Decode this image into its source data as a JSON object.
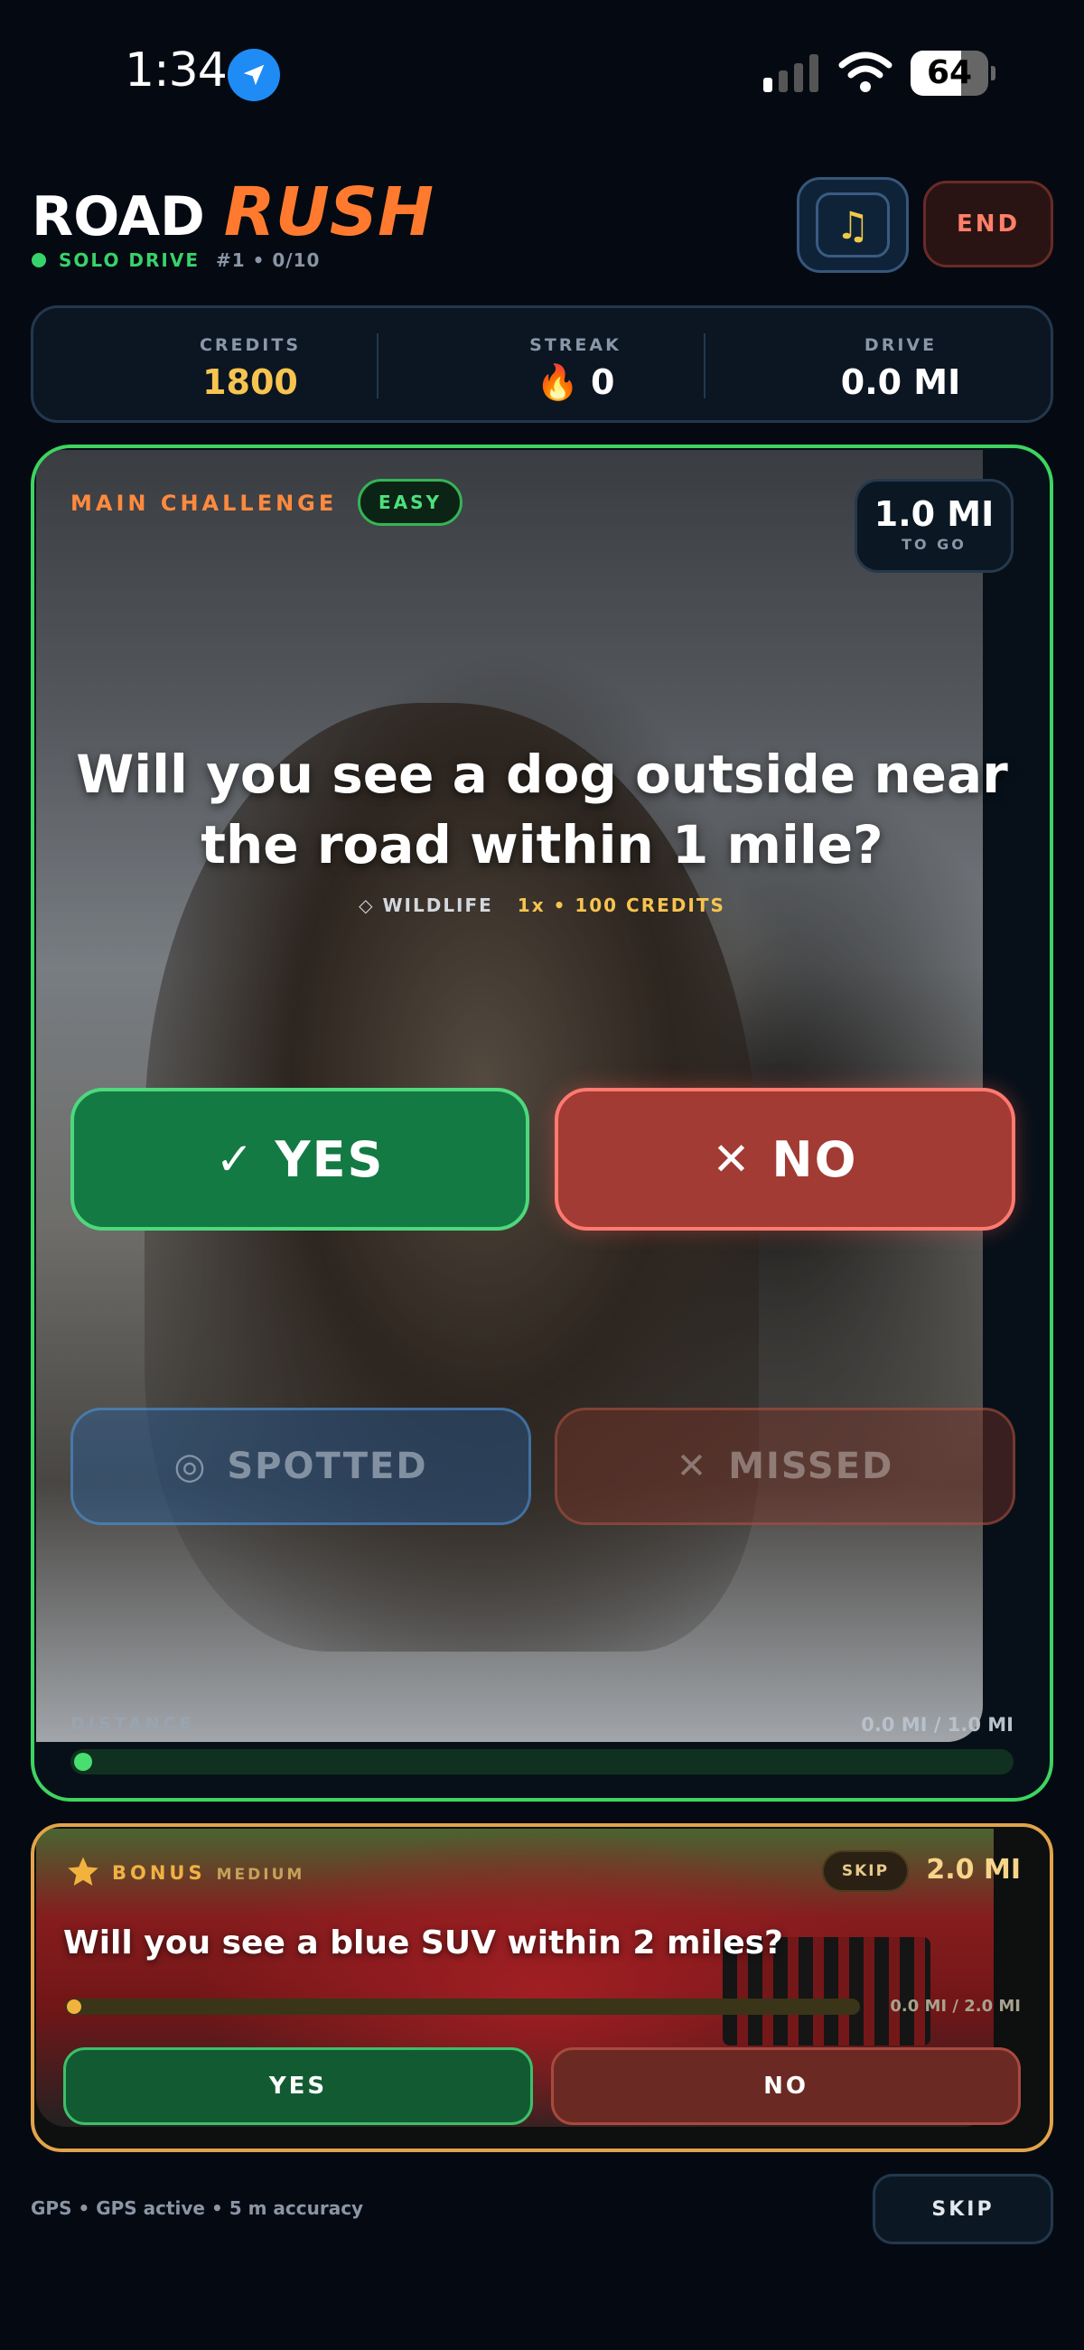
{
  "status_bar": {
    "time": "1:34",
    "battery": "64",
    "icons": [
      "location-arrow-icon",
      "signal-icon",
      "wifi-icon",
      "battery-icon"
    ]
  },
  "header": {
    "logo_word1": "ROAD",
    "logo_word2": "RUSH",
    "mode": "SOLO DRIVE",
    "progress": "#1 • 0/10",
    "music_icon": "♫",
    "end_label": "END"
  },
  "stats": {
    "credits_label": "CREDITS",
    "credits_value": "1800",
    "streak_label": "STREAK",
    "streak_icon": "🔥",
    "streak_value": "0",
    "drive_label": "DRIVE",
    "drive_value": "0.0 MI"
  },
  "main_challenge": {
    "label": "MAIN CHALLENGE",
    "difficulty": "EASY",
    "to_go_value": "1.0 MI",
    "to_go_label": "TO GO",
    "question": "Will you see a dog outside near the road within 1 mile?",
    "category": "◇ WILDLIFE",
    "reward": "1x • 100 CREDITS",
    "yes_icon": "✓",
    "yes_label": "YES",
    "no_icon": "✕",
    "no_label": "NO",
    "spotted_icon": "◎",
    "spotted_label": "SPOTTED",
    "missed_icon": "✕",
    "missed_label": "MISSED",
    "distance_label": "DISTANCE",
    "distance_value": "0.0 MI / 1.0 MI",
    "distance_progress": 0
  },
  "bonus_challenge": {
    "label": "BONUS",
    "difficulty": "MEDIUM",
    "skip_label": "SKIP",
    "distance": "2.0 MI",
    "question": "Will you see a blue SUV within 2 miles?",
    "progress_text": "0.0 MI / 2.0 MI",
    "progress": 0,
    "yes_label": "YES",
    "no_label": "NO"
  },
  "footer": {
    "gps_status": "GPS • GPS active • 5 m accuracy",
    "skip_label": "SKIP"
  },
  "colors": {
    "accent_orange": "#ff7a2e",
    "success_green": "#3ed460",
    "danger_red": "#a23b33",
    "gold": "#f7c44f"
  }
}
